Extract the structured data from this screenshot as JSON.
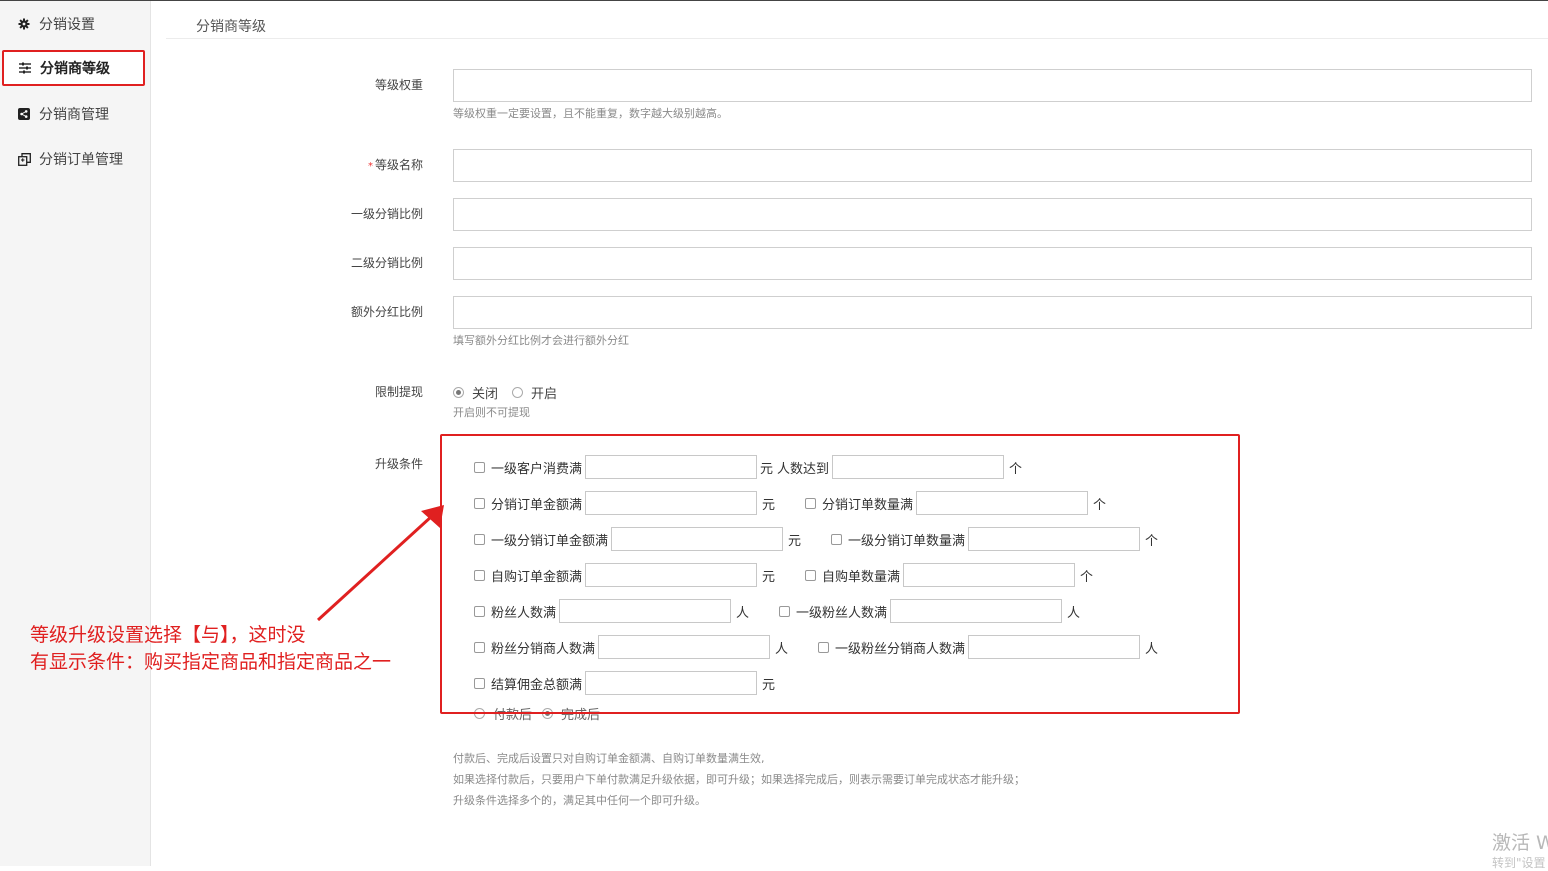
{
  "sidebar": {
    "items": [
      {
        "label": "分销设置",
        "icon": "gear-icon"
      },
      {
        "label": "分销商等级",
        "icon": "sliders-icon",
        "active": true
      },
      {
        "label": "分销商管理",
        "icon": "share-icon"
      },
      {
        "label": "分销订单管理",
        "icon": "copy-icon"
      }
    ]
  },
  "page": {
    "section_title": "分销商等级"
  },
  "form": {
    "weight": {
      "label": "等级权重",
      "value": "",
      "help": "等级权重一定要设置，且不能重复，数字越大级别越高。"
    },
    "name": {
      "required_mark": "*",
      "label": "等级名称",
      "value": ""
    },
    "ratio1": {
      "label": "一级分销比例",
      "value": ""
    },
    "ratio2": {
      "label": "二级分销比例",
      "value": ""
    },
    "extra": {
      "label": "额外分红比例",
      "value": "",
      "help": "填写额外分红比例才会进行额外分红"
    },
    "limit_withdraw": {
      "label": "限制提现",
      "options": [
        "关闭",
        "开启"
      ],
      "selected": "关闭",
      "help": "开启则不可提现"
    },
    "upgrade": {
      "label": "升级条件",
      "rows": [
        {
          "a_label": "一级客户消费满",
          "a_value": "",
          "a_unit": "元",
          "b_label": "人数达到",
          "b_value": "",
          "b_unit": "个"
        },
        {
          "a_label": "分销订单金额满",
          "a_value": "",
          "a_unit": "元",
          "b_label": "分销订单数量满",
          "b_value": "",
          "b_unit": "个"
        },
        {
          "a_label": "一级分销订单金额满",
          "a_value": "",
          "a_unit": "元",
          "b_label": "一级分销订单数量满",
          "b_value": "",
          "b_unit": "个"
        },
        {
          "a_label": "自购订单金额满",
          "a_value": "",
          "a_unit": "元",
          "b_label": "自购单数量满",
          "b_value": "",
          "b_unit": "个"
        },
        {
          "a_label": "粉丝人数满",
          "a_value": "",
          "a_unit": "人",
          "b_label": "一级粉丝人数满",
          "b_value": "",
          "b_unit": "人"
        },
        {
          "a_label": "粉丝分销商人数满",
          "a_value": "",
          "a_unit": "人",
          "b_label": "一级粉丝分销商人数满",
          "b_value": "",
          "b_unit": "人"
        },
        {
          "a_label": "结算佣金总额满",
          "a_value": "",
          "a_unit": "元"
        }
      ],
      "timing_options": [
        "付款后",
        "完成后"
      ],
      "timing_selected": "完成后",
      "notes": [
        "付款后、完成后设置只对自购订单金额满、自购订单数量满生效,",
        "如果选择付款后，只要用户下单付款满足升级依据，即可升级；如果选择完成后，则表示需要订单完成状态才能升级；",
        "升级条件选择多个的，满足其中任何一个即可升级。"
      ]
    }
  },
  "annotation": {
    "line1": "等级升级设置选择【与】，这时没",
    "line2": "有显示条件：购买指定商品和指定商品之一",
    "color": "#e02020"
  },
  "watermark": {
    "line1": "激活 W",
    "line2": "转到\"设置"
  }
}
